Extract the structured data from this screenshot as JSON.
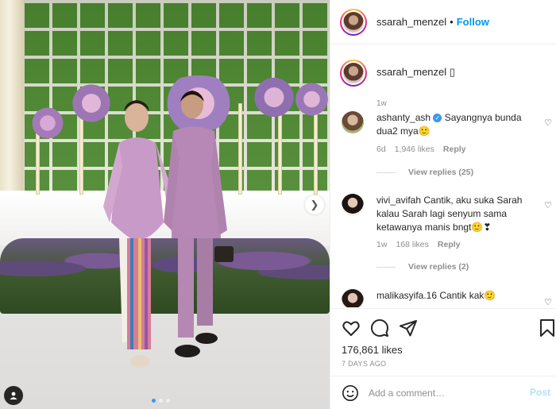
{
  "post": {
    "username": "ssarah_menzel",
    "follow_label": "Follow",
    "separator": "•",
    "slide_count": 3,
    "active_slide": 1
  },
  "caption": {
    "username": "ssarah_menzel",
    "text": "▯",
    "time": "1w"
  },
  "comments": [
    {
      "username": "ashanty_ash",
      "verified": true,
      "text": "Sayangnya bunda dua2 mya🙂",
      "time": "6d",
      "likes": "1,946 likes",
      "reply_label": "Reply",
      "view_replies": "View replies (25)"
    },
    {
      "username": "vivi_avifah",
      "verified": false,
      "text": "Cantik, aku suka Sarah kalau Sarah lagi senyum sama ketawanya manis bngt🙂❣",
      "time": "1w",
      "likes": "168 likes",
      "reply_label": "Reply",
      "view_replies": "View replies (2)"
    },
    {
      "username": "malikasyifa.16",
      "verified": false,
      "text": "Cantik kak🙂"
    }
  ],
  "stats": {
    "likes": "176,861 likes",
    "posted": "7 DAYS AGO"
  },
  "composer": {
    "placeholder": "Add a comment…",
    "post_label": "Post"
  },
  "icons": {
    "heart": "heart-icon",
    "comment": "comment-icon",
    "share": "share-icon",
    "save": "bookmark-icon",
    "emoji": "emoji-icon",
    "next": "chevron-right-icon",
    "tag": "user-tag-icon"
  },
  "colors": {
    "accent": "#0095f6",
    "post_disabled": "#b2dffc",
    "muted": "#8e8e8e"
  }
}
